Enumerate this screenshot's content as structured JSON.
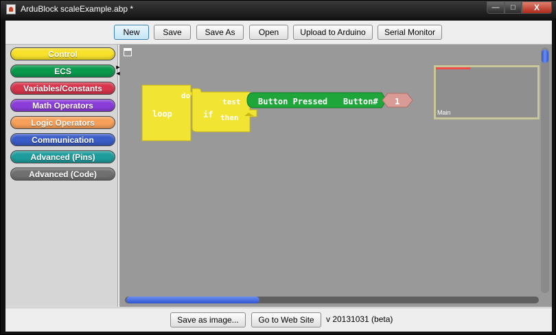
{
  "window": {
    "title": "ArduBlock scaleExample.abp *",
    "min_label": "—",
    "max_label": "□",
    "close_label": "X"
  },
  "toolbar": {
    "buttons": [
      "New",
      "Save",
      "Save As",
      "Open",
      "Upload to Arduino",
      "Serial Monitor"
    ]
  },
  "palette": {
    "categories": [
      {
        "label": "Control",
        "color": "#f7e12a"
      },
      {
        "label": "ECS",
        "color": "#0a9a4d"
      },
      {
        "label": "Variables/Constants",
        "color": "#d7354b"
      },
      {
        "label": "Math Operators",
        "color": "#8a3dd8"
      },
      {
        "label": "Logic Operators",
        "color": "#f7a05a"
      },
      {
        "label": "Communication",
        "color": "#3a5cc8"
      },
      {
        "label": "Advanced (Pins)",
        "color": "#1e9c9c"
      },
      {
        "label": "Advanced (Code)",
        "color": "#707070"
      }
    ]
  },
  "workspace": {
    "blocks": {
      "loop": {
        "label": "loop",
        "socket": "do",
        "color": "#f2e433"
      },
      "if": {
        "label": "if",
        "test_socket": "test",
        "then_socket": "then",
        "color": "#f2e433"
      },
      "button_pressed": {
        "label": "Button Pressed",
        "param": "Button#",
        "color": "#1fa63a"
      },
      "number": {
        "value": "1",
        "color": "#d89b95"
      }
    },
    "minimap_label": "Main",
    "colors": {
      "canvas": "#999999",
      "scroll_accent": "#3a5fd6"
    }
  },
  "bottom": {
    "save_image": "Save as image...",
    "web_site": "Go to Web Site",
    "version": "v 20131031 (beta)"
  }
}
